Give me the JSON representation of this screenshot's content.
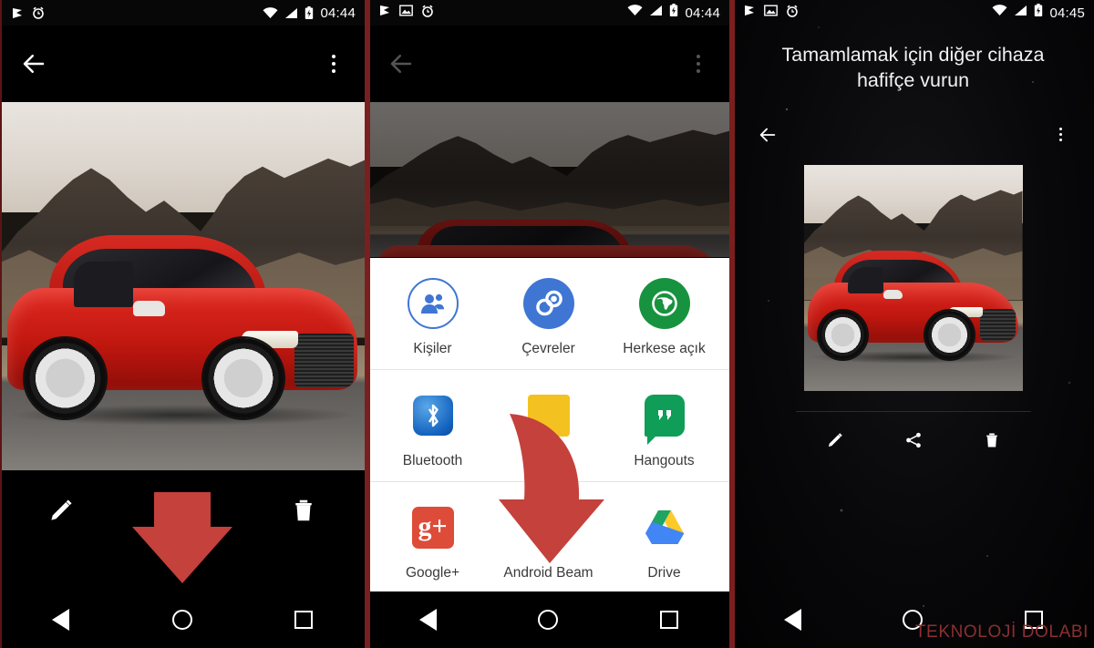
{
  "panels": [
    {
      "id": "viewer",
      "statusbar": {
        "time": "04:44",
        "left_icons": [
          "mute-flag-icon",
          "alarm-icon"
        ],
        "right_icons": [
          "wifi-icon",
          "signal-icon",
          "battery-charging-icon"
        ]
      },
      "appbar": {
        "back": "back-arrow-icon",
        "overflow": "overflow-menu-icon"
      },
      "photo": {
        "alt": "red-audi-coupe-mountains"
      },
      "actions": [
        {
          "name": "edit",
          "icon": "pencil-icon"
        },
        {
          "name": "share",
          "icon": "share-icon"
        },
        {
          "name": "delete",
          "icon": "trash-icon"
        }
      ],
      "nav": [
        "back",
        "home",
        "recents"
      ]
    },
    {
      "id": "share-sheet",
      "statusbar": {
        "time": "04:44",
        "left_icons": [
          "mute-flag-icon",
          "photo-icon",
          "alarm-icon"
        ],
        "right_icons": [
          "wifi-icon",
          "signal-icon",
          "battery-charging-icon"
        ]
      },
      "appbar": {
        "back": "back-arrow-icon",
        "overflow": "overflow-menu-icon"
      },
      "sheet": {
        "rows": [
          [
            {
              "label": "Kişiler",
              "icon": "people-circle-icon",
              "color": "#3f76d4"
            },
            {
              "label": "Çevreler",
              "icon": "google-circles-icon",
              "color": "#3f76d4"
            },
            {
              "label": "Herkese açık",
              "icon": "globe-icon",
              "color": "#17933f"
            }
          ],
          [
            {
              "label": "Bluetooth",
              "icon": "bluetooth-icon",
              "color": "#1565c0"
            },
            {
              "label": "",
              "icon": "photos-icon",
              "color": "#f4c220"
            },
            {
              "label": "Hangouts",
              "icon": "hangouts-icon",
              "color": "#0f9d58"
            }
          ],
          [
            {
              "label": "Google+",
              "icon": "google-plus-icon",
              "color": "#dd4b39"
            },
            {
              "label": "Android Beam",
              "icon": "android-beam-icon",
              "color": "#8bc34a"
            },
            {
              "label": "Drive",
              "icon": "google-drive-icon",
              "color": "#ffc107"
            }
          ]
        ]
      },
      "nav": [
        "back",
        "home",
        "recents"
      ]
    },
    {
      "id": "beam",
      "statusbar": {
        "time": "04:45",
        "left_icons": [
          "mute-flag-icon",
          "photo-icon",
          "alarm-icon"
        ],
        "right_icons": [
          "wifi-icon",
          "signal-icon",
          "battery-charging-icon"
        ]
      },
      "title": "Tamamlamak için diğer cihaza hafifçe vurun",
      "minibar": {
        "back": "back-arrow-icon",
        "overflow": "overflow-menu-icon"
      },
      "thumb": {
        "alt": "red-audi-coupe-mountains"
      },
      "actions": [
        {
          "name": "edit",
          "icon": "pencil-icon"
        },
        {
          "name": "share",
          "icon": "share-icon"
        },
        {
          "name": "delete",
          "icon": "trash-icon"
        }
      ],
      "nav": [
        "back",
        "home",
        "recents"
      ]
    }
  ],
  "annotations": {
    "arrow_color": "#c4413c",
    "arrow_1_target": "share-button-panel-1",
    "arrow_2_target": "android-beam-target"
  },
  "watermark": {
    "text": "TEKNOLOJİ DOLABI",
    "color": "#8c2f2f"
  }
}
